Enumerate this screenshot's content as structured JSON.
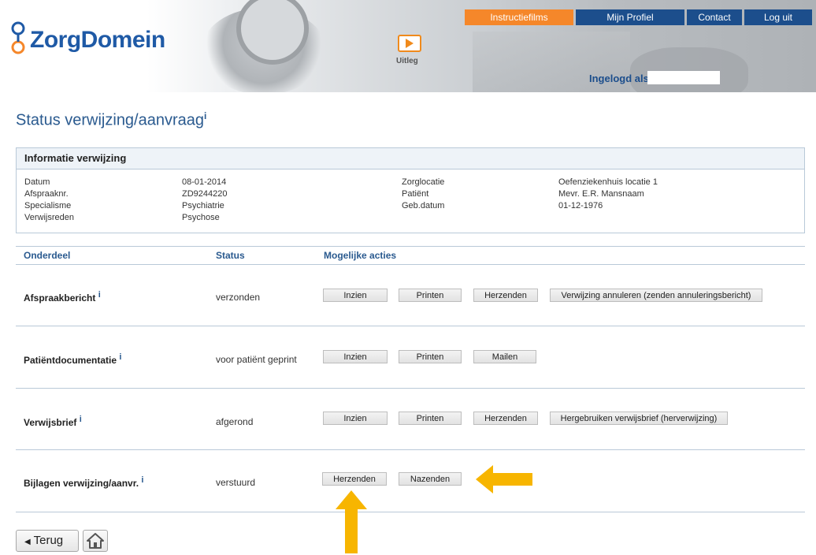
{
  "header": {
    "brand": "ZorgDomein",
    "uitleg_label": "Uitleg",
    "nav": [
      "Instructiefilms",
      "Mijn Profiel",
      "Contact",
      "Log uit"
    ],
    "logged_in_label": "Ingelogd als:"
  },
  "page": {
    "title": "Status verwijzing/aanvraag",
    "info_marker": "i"
  },
  "info": {
    "heading": "Informatie verwijzing",
    "left": [
      {
        "label": "Datum",
        "value": "08-01-2014"
      },
      {
        "label": "Afspraaknr.",
        "value": "ZD9244220"
      },
      {
        "label": "Specialisme",
        "value": "Psychiatrie"
      },
      {
        "label": "Verwijsreden",
        "value": "Psychose"
      }
    ],
    "right": [
      {
        "label": "Zorglocatie",
        "value": "Oefenziekenhuis locatie 1"
      },
      {
        "label": "Patiënt",
        "value": "Mevr. E.R. Mansnaam"
      },
      {
        "label": "Geb.datum",
        "value": "01-12-1976"
      }
    ]
  },
  "table": {
    "headers": [
      "Onderdeel",
      "Status",
      "Mogelijke acties"
    ],
    "rows": [
      {
        "label": "Afspraakbericht",
        "status": "verzonden",
        "actions": [
          "Inzien",
          "Printen",
          "Herzenden",
          "Verwijzing annuleren (zenden annuleringsbericht)"
        ]
      },
      {
        "label": "Patiëntdocumentatie",
        "status": "voor patiënt geprint",
        "actions": [
          "Inzien",
          "Printen",
          "Mailen"
        ]
      },
      {
        "label": "Verwijsbrief",
        "status": "afgerond",
        "actions": [
          "Inzien",
          "Printen",
          "Herzenden",
          "Hergebruiken verwijsbrief (herverwijzing)"
        ]
      },
      {
        "label": "Bijlagen verwijzing/aanvr.",
        "status": "verstuurd",
        "actions": [
          "Herzenden",
          "Nazenden"
        ]
      }
    ]
  },
  "footer": {
    "back_label": "Terug"
  },
  "colors": {
    "accent_orange": "#f5872a",
    "nav_blue": "#1c4e8c",
    "arrow_yellow": "#f7b500"
  }
}
